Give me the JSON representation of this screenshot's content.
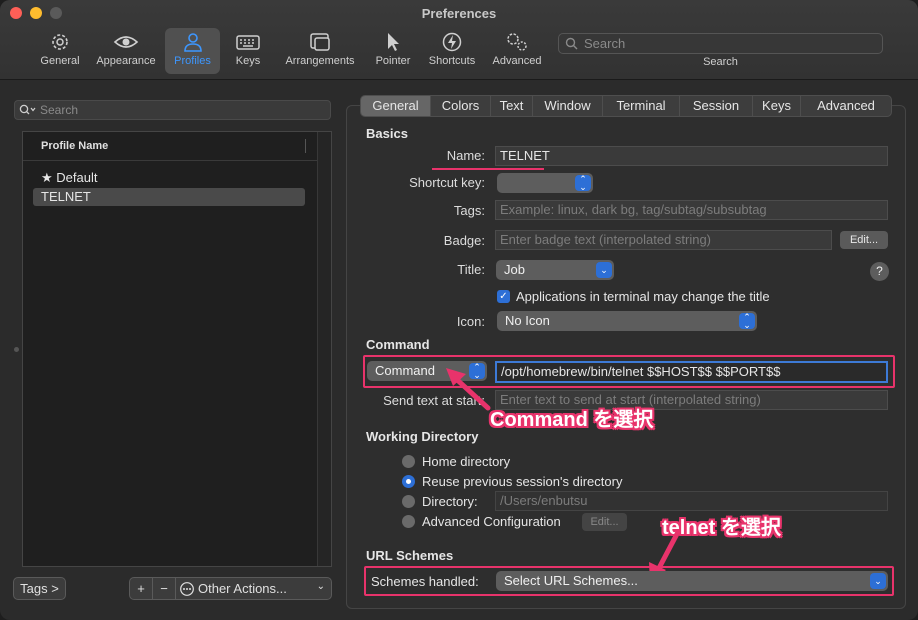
{
  "window": {
    "title": "Preferences"
  },
  "toolbar": {
    "items": [
      {
        "label": "General",
        "icon": "gear-icon"
      },
      {
        "label": "Appearance",
        "icon": "eye-icon"
      },
      {
        "label": "Profiles",
        "icon": "person-icon"
      },
      {
        "label": "Keys",
        "icon": "keyboard-icon"
      },
      {
        "label": "Arrangements",
        "icon": "windows-icon"
      },
      {
        "label": "Pointer",
        "icon": "pointer-icon"
      },
      {
        "label": "Shortcuts",
        "icon": "lightning-icon"
      },
      {
        "label": "Advanced",
        "icon": "gears-icon"
      }
    ],
    "search_placeholder": "Search",
    "search_label": "Search"
  },
  "sidebar": {
    "search_placeholder": "Search",
    "column_header": "Profile Name",
    "profiles": [
      "★ Default",
      "TELNET"
    ],
    "tags_button": "Tags >",
    "add_button": "+",
    "remove_button": "−",
    "other_actions": "Other Actions..."
  },
  "tabs": [
    "General",
    "Colors",
    "Text",
    "Window",
    "Terminal",
    "Session",
    "Keys",
    "Advanced"
  ],
  "basics": {
    "section": "Basics",
    "name_label": "Name:",
    "name_value": "TELNET",
    "shortcut_label": "Shortcut key:",
    "tags_label": "Tags:",
    "tags_placeholder": "Example: linux, dark bg, tag/subtag/subsubtag",
    "badge_label": "Badge:",
    "badge_placeholder": "Enter badge text (interpolated string)",
    "badge_edit": "Edit...",
    "title_label": "Title:",
    "title_value": "Job",
    "help": "?",
    "apps_change_title": "Applications in terminal may change the title",
    "icon_label": "Icon:",
    "icon_value": "No Icon"
  },
  "command": {
    "section": "Command",
    "mode": "Command",
    "value": "/opt/homebrew/bin/telnet $$HOST$$ $$PORT$$",
    "send_text_label": "Send text at start:",
    "send_text_placeholder": "Enter text to send at start (interpolated string)"
  },
  "working_directory": {
    "section": "Working Directory",
    "options": [
      "Home directory",
      "Reuse previous session's directory",
      "Directory:",
      "Advanced Configuration"
    ],
    "selected": 1,
    "directory_placeholder": "/Users/enbutsu",
    "edit": "Edit..."
  },
  "url_schemes": {
    "section": "URL Schemes",
    "label": "Schemes handled:",
    "value": "Select URL Schemes..."
  },
  "annotations": {
    "command_note": "Command を選択",
    "telnet_note": "telnet を選択"
  },
  "colors": {
    "accent": "#2d6fd6",
    "highlight": "#e8336b",
    "active_tab": "#3d97ff"
  }
}
